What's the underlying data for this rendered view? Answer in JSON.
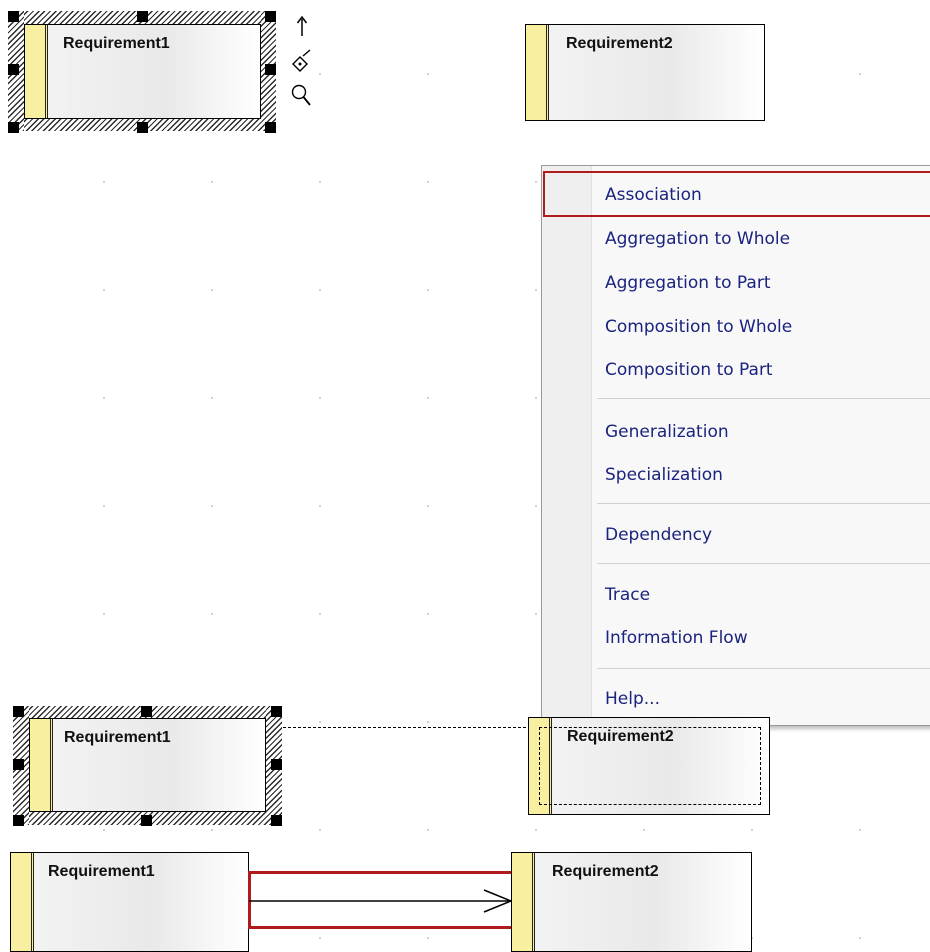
{
  "diagram": {
    "top_row": {
      "source_element": "Requirement1",
      "target_element": "Requirement2"
    },
    "toolbar_icons": [
      "quick-link-arrow-icon",
      "tag-icon",
      "magnifier-icon"
    ],
    "context_menu": {
      "items": [
        "Association",
        "Aggregation to Whole",
        "Aggregation to Part",
        "Composition to Whole",
        "Composition to Part",
        "Generalization",
        "Specialization",
        "Dependency",
        "Trace",
        "Information Flow",
        "Help..."
      ],
      "highlighted_item": "Association"
    },
    "middle_row": {
      "source_element": "Requirement1",
      "target_element": "Requirement2"
    },
    "bottom_row": {
      "source_element": "Requirement1",
      "target_element": "Requirement2"
    }
  },
  "colors": {
    "stripe": "#f8f0a0",
    "highlight": "#b01b1b",
    "menu_text": "#1a237e"
  }
}
